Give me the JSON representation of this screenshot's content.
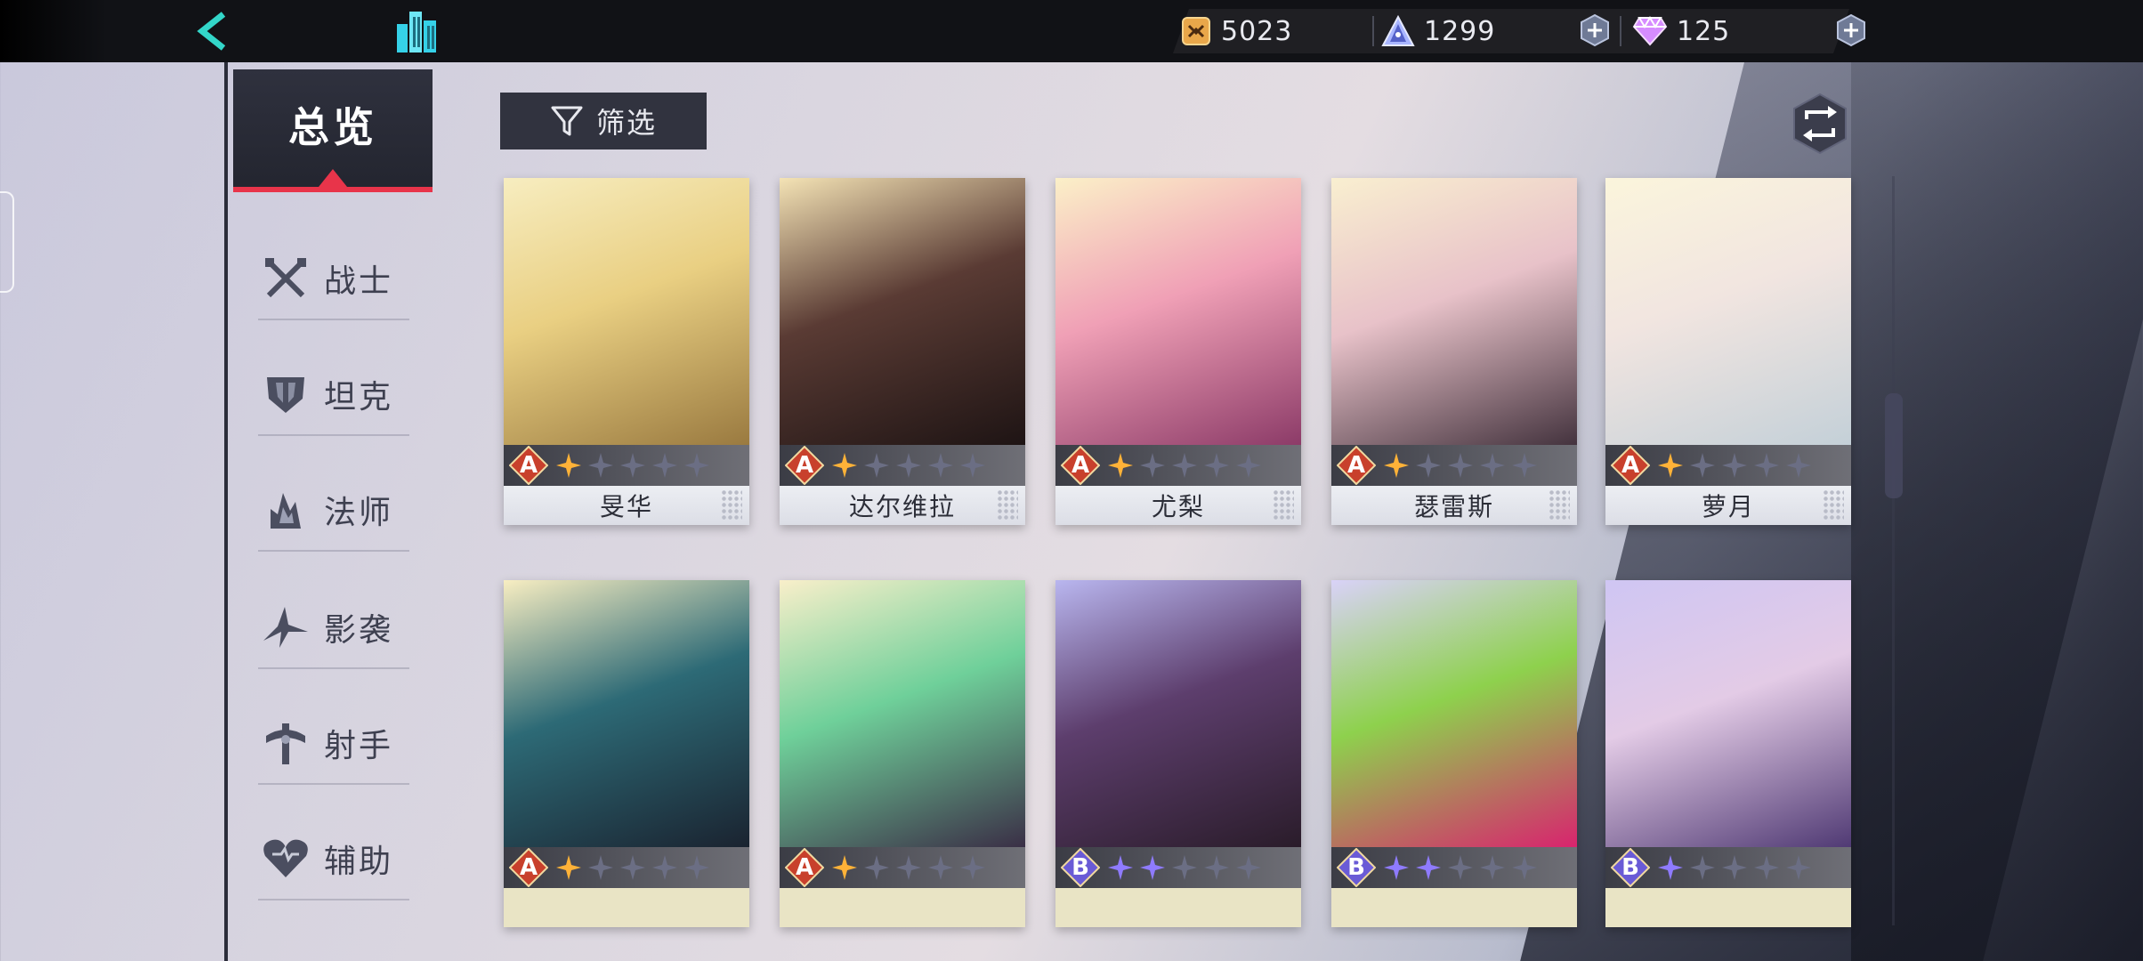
{
  "topbar": {
    "resources": [
      {
        "icon": "gold-coin-icon",
        "value": "5023"
      },
      {
        "icon": "pyramid-crystal-icon",
        "value": "1299"
      },
      {
        "icon": "diamond-gem-icon",
        "value": "125"
      }
    ]
  },
  "sidebar": {
    "overview_label": "总览",
    "categories": [
      {
        "label": "战士",
        "icon": "crossed-swords-icon"
      },
      {
        "label": "坦克",
        "icon": "armor-shield-icon"
      },
      {
        "label": "法师",
        "icon": "mage-flame-icon"
      },
      {
        "label": "影袭",
        "icon": "shuriken-icon"
      },
      {
        "label": "射手",
        "icon": "crossbow-icon"
      },
      {
        "label": "辅助",
        "icon": "heart-icon"
      }
    ]
  },
  "toolbar": {
    "filter_label": "筛选"
  },
  "heroes": [
    {
      "name": "旻华",
      "rank": "A",
      "stars": 1
    },
    {
      "name": "达尔维拉",
      "rank": "A",
      "stars": 1
    },
    {
      "name": "尤梨",
      "rank": "A",
      "stars": 1
    },
    {
      "name": "瑟雷斯",
      "rank": "A",
      "stars": 1
    },
    {
      "name": "萝月",
      "rank": "A",
      "stars": 1
    },
    {
      "name": "",
      "rank": "A",
      "stars": 1
    },
    {
      "name": "",
      "rank": "A",
      "stars": 1
    },
    {
      "name": "",
      "rank": "B",
      "stars": 2
    },
    {
      "name": "",
      "rank": "B",
      "stars": 2
    },
    {
      "name": "",
      "rank": "B",
      "stars": 1
    }
  ],
  "colors": {
    "accent_red": "#e8344a",
    "rank_a": "#c8402c",
    "rank_b": "#6a5bd6",
    "star_gold": "#ffb238",
    "star_purple": "#8f7bff"
  }
}
